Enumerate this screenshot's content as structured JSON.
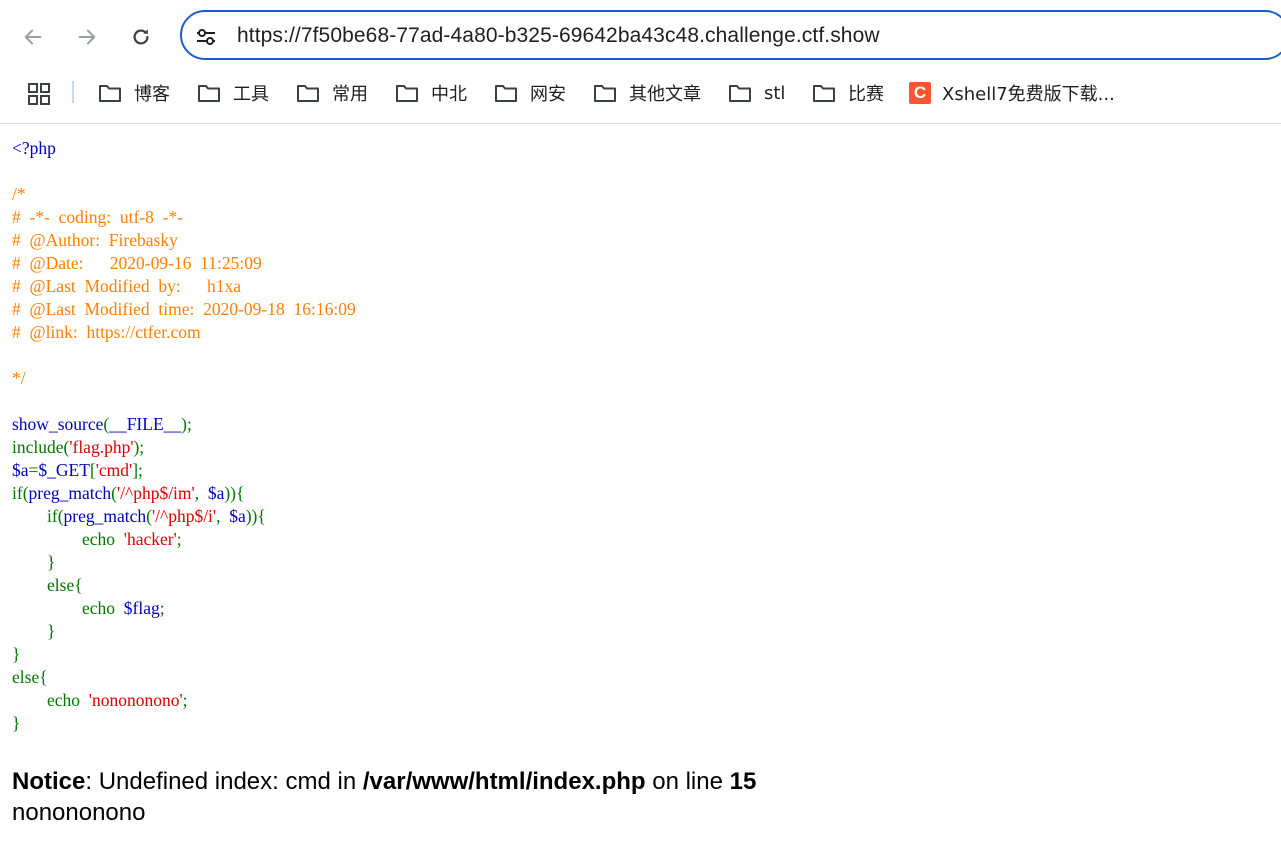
{
  "browser": {
    "url": "https://7f50be68-77ad-4a80-b325-69642ba43c48.challenge.ctf.show",
    "back_icon": "arrow-left-icon",
    "forward_icon": "arrow-right-icon",
    "reload_icon": "reload-icon",
    "site_info_icon": "tune-icon"
  },
  "bookmarks": [
    {
      "label": "博客",
      "icon": "folder-icon"
    },
    {
      "label": "工具",
      "icon": "folder-icon"
    },
    {
      "label": "常用",
      "icon": "folder-icon"
    },
    {
      "label": "中北",
      "icon": "folder-icon"
    },
    {
      "label": "网安",
      "icon": "folder-icon"
    },
    {
      "label": "其他文章",
      "icon": "folder-icon"
    },
    {
      "label": "stl",
      "icon": "folder-icon"
    },
    {
      "label": "比赛",
      "icon": "folder-icon"
    },
    {
      "label": "Xshell7免费版下载...",
      "icon": "csdn-icon",
      "icon_text": "C"
    }
  ],
  "colors": {
    "php_default": "#0000bb",
    "php_comment": "#ff8000",
    "php_keyword": "#007700",
    "php_string": "#dd0000",
    "omnibox_border": "#1a5fce",
    "csdn_brand": "#fc5531"
  },
  "source_lines": [
    [
      {
        "t": "<?php",
        "c": "default"
      }
    ],
    [],
    [
      {
        "t": "/*",
        "c": "comment"
      }
    ],
    [
      {
        "t": "#  -*-  coding:  utf-8  -*-",
        "c": "comment"
      }
    ],
    [
      {
        "t": "#  @Author:  Firebasky",
        "c": "comment"
      }
    ],
    [
      {
        "t": "#  @Date:      2020-09-16  11:25:09",
        "c": "comment"
      }
    ],
    [
      {
        "t": "#  @Last  Modified  by:      h1xa",
        "c": "comment"
      }
    ],
    [
      {
        "t": "#  @Last  Modified  time:  2020-09-18  16:16:09",
        "c": "comment"
      }
    ],
    [
      {
        "t": "#  @link:  https://ctfer.com",
        "c": "comment"
      }
    ],
    [],
    [
      {
        "t": "*/",
        "c": "comment"
      }
    ],
    [],
    [
      {
        "t": "show_source",
        "c": "default"
      },
      {
        "t": "(",
        "c": "keyword"
      },
      {
        "t": "__FILE__",
        "c": "default"
      },
      {
        "t": ");",
        "c": "keyword"
      }
    ],
    [
      {
        "t": "include(",
        "c": "keyword"
      },
      {
        "t": "'flag.php'",
        "c": "string"
      },
      {
        "t": ");",
        "c": "keyword"
      }
    ],
    [
      {
        "t": "$a",
        "c": "default"
      },
      {
        "t": "=",
        "c": "keyword"
      },
      {
        "t": "$_GET",
        "c": "default"
      },
      {
        "t": "[",
        "c": "keyword"
      },
      {
        "t": "'cmd'",
        "c": "string"
      },
      {
        "t": "];",
        "c": "keyword"
      }
    ],
    [
      {
        "t": "if(",
        "c": "keyword"
      },
      {
        "t": "preg_match",
        "c": "default"
      },
      {
        "t": "(",
        "c": "keyword"
      },
      {
        "t": "'/^php$/im'",
        "c": "string"
      },
      {
        "t": ",  ",
        "c": "keyword"
      },
      {
        "t": "$a",
        "c": "default"
      },
      {
        "t": ")){",
        "c": "keyword"
      }
    ],
    [
      {
        "t": "        if(",
        "c": "keyword"
      },
      {
        "t": "preg_match",
        "c": "default"
      },
      {
        "t": "(",
        "c": "keyword"
      },
      {
        "t": "'/^php$/i'",
        "c": "string"
      },
      {
        "t": ",  ",
        "c": "keyword"
      },
      {
        "t": "$a",
        "c": "default"
      },
      {
        "t": ")){",
        "c": "keyword"
      }
    ],
    [
      {
        "t": "                echo  ",
        "c": "keyword"
      },
      {
        "t": "'hacker'",
        "c": "string"
      },
      {
        "t": ";",
        "c": "keyword"
      }
    ],
    [
      {
        "t": "        }",
        "c": "keyword"
      }
    ],
    [
      {
        "t": "        else{",
        "c": "keyword"
      }
    ],
    [
      {
        "t": "                echo  ",
        "c": "keyword"
      },
      {
        "t": "$flag",
        "c": "default"
      },
      {
        "t": ";",
        "c": "keyword"
      }
    ],
    [
      {
        "t": "        }",
        "c": "keyword"
      }
    ],
    [
      {
        "t": "}",
        "c": "keyword"
      }
    ],
    [
      {
        "t": "else{",
        "c": "keyword"
      }
    ],
    [
      {
        "t": "        echo  ",
        "c": "keyword"
      },
      {
        "t": "'nonononono'",
        "c": "string"
      },
      {
        "t": ";",
        "c": "keyword"
      }
    ],
    [
      {
        "t": "}",
        "c": "keyword"
      }
    ]
  ],
  "notice": {
    "label": "Notice",
    "text": ": Undefined index: cmd in ",
    "path": "/var/www/html/index.php",
    "on_line": " on line ",
    "line_no": "15"
  },
  "output_text": "nonononono"
}
